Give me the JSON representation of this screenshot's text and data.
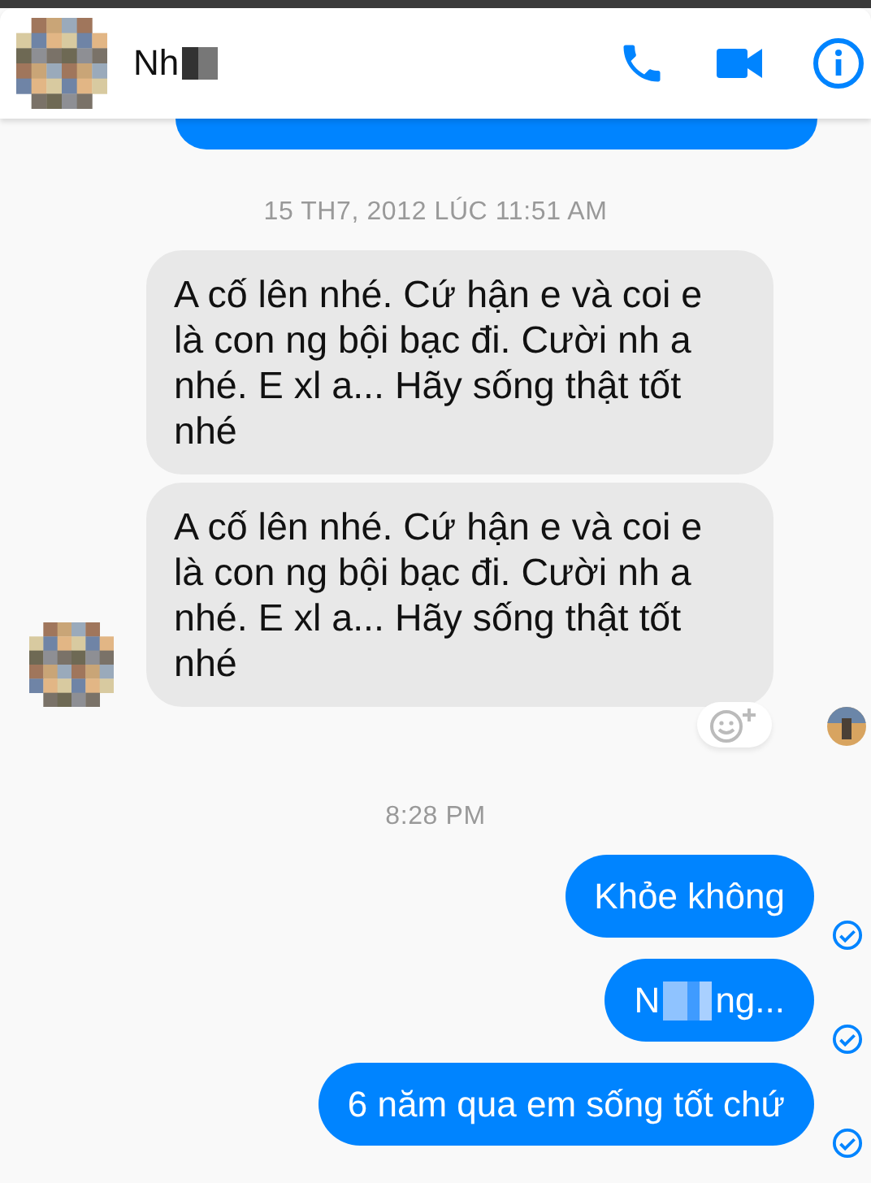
{
  "header": {
    "name": "Nh",
    "name_redacted": true
  },
  "timestamps": [
    "15 TH7, 2012 LÚC 11:51 AM",
    "8:28 PM"
  ],
  "incoming": [
    {
      "text": "A cố lên nhé. Cứ hận e và coi e là con ng bội bạc đi. Cười nh a nhé. E xl a... Hãy sống thật tốt nhé"
    },
    {
      "text": "A cố lên nhé. Cứ hận e và coi e là con ng bội bạc đi. Cười nh a nhé. E xl a... Hãy sống thật tốt nhé"
    }
  ],
  "outgoing": [
    {
      "before": "Khỏe không",
      "redacted": false,
      "delivered": true
    },
    {
      "before": "N",
      "redacted": true,
      "after": "ng...",
      "delivered": true
    },
    {
      "before": "6 năm qua em sống tốt chứ",
      "redacted": false,
      "delivered": true
    }
  ]
}
